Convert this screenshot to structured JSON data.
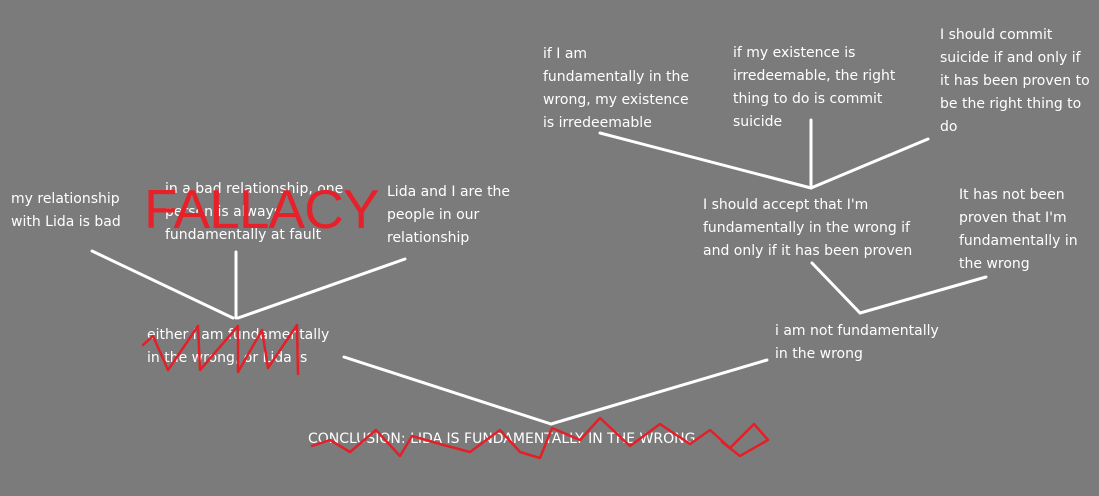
{
  "premises": {
    "relationship_bad": "my relationship\nwith Lida is bad",
    "one_at_fault": "in a bad relationship, one\nperson is always\nfundamentally at fault",
    "people_in_relationship": "Lida and I are the\npeople in our\nrelationship",
    "either_or": "either I am fundamentally\nin the wrong, or Lida is",
    "irredeemable": "if I am\nfundamentally in the\nwrong, my existence\nis irredeemable",
    "right_thing": "if my existence is\nirredeemable, the right\nthing to do is commit\nsuicide",
    "if_proven": "I should commit\nsuicide if and only if\nit has been proven to\nbe the right thing to\ndo",
    "accept_if_proven": "I should accept that I'm\nfundamentally in the wrong if\nand only if it has been proven",
    "not_proven": "It has not been\nproven that I'm\nfundamentally in\nthe wrong",
    "not_wrong": "i am not fundamentally\nin the wrong"
  },
  "overlay": {
    "fallacy": "FALLACY"
  },
  "conclusion": "CONCLUSION: LIDA IS FUNDAMENTALLY IN THE WRONG",
  "colors": {
    "background": "#7b7b7b",
    "text": "#ffffff",
    "scribble": "#e32028"
  }
}
